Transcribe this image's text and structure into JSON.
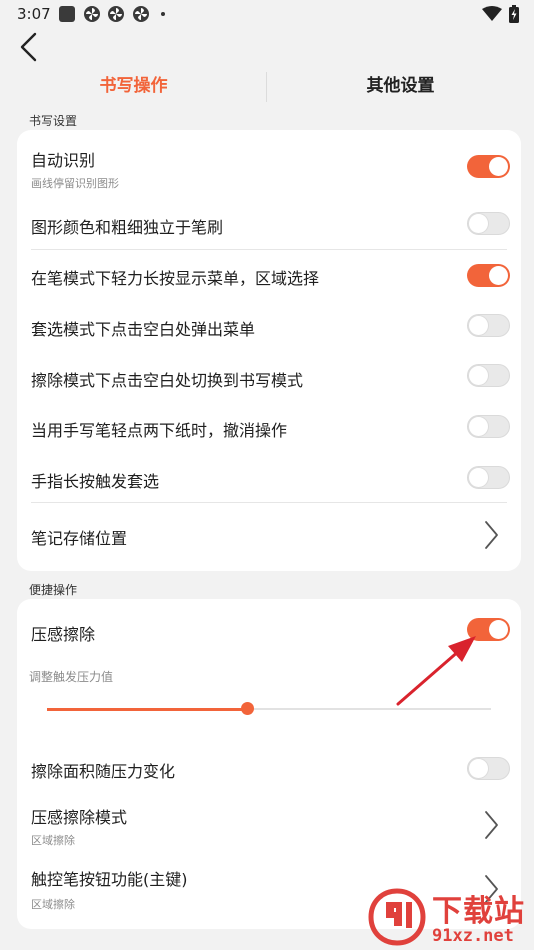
{
  "status_bar": {
    "time": "3:07",
    "icons": [
      "photo-icon",
      "pinwheel-icon",
      "pinwheel-icon",
      "pinwheel-icon",
      "dot-icon",
      "wifi-icon",
      "battery-charging-icon"
    ]
  },
  "header": {
    "back_icon": "back-chevron-icon",
    "tabs": [
      {
        "label": "书写操作",
        "active": true
      },
      {
        "label": "其他设置",
        "active": false
      }
    ]
  },
  "sections": [
    {
      "label": "书写设置",
      "items": [
        {
          "label": "自动识别",
          "subtitle": "画线停留识别图形",
          "control": "toggle",
          "on": true
        },
        {
          "label": "图形颜色和粗细独立于笔刷",
          "control": "toggle",
          "on": false
        },
        {
          "label": "在笔模式下轻力长按显示菜单，区域选择",
          "control": "toggle",
          "on": true
        },
        {
          "label": "套选模式下点击空白处弹出菜单",
          "control": "toggle",
          "on": false
        },
        {
          "label": "擦除模式下点击空白处切换到书写模式",
          "control": "toggle",
          "on": false
        },
        {
          "label": "当用手写笔轻点两下纸时，撤消操作",
          "control": "toggle",
          "on": false
        },
        {
          "label": "手指长按触发套选",
          "control": "toggle",
          "on": false
        },
        {
          "label": "笔记存储位置",
          "control": "chevron"
        }
      ]
    },
    {
      "label": "便捷操作",
      "items": [
        {
          "label": "压感擦除",
          "control": "toggle",
          "on": true
        },
        {
          "label": "调整触发压力值",
          "control": "slider",
          "value_fraction": 0.45
        },
        {
          "label": "擦除面积随压力变化",
          "control": "toggle",
          "on": false
        },
        {
          "label": "压感擦除模式",
          "subtitle": "区域擦除",
          "control": "chevron"
        },
        {
          "label": "触控笔按钮功能(主键)",
          "subtitle": "区域擦除",
          "control": "chevron"
        }
      ]
    }
  ],
  "annotation": {
    "icon": "red-arrow-icon",
    "color": "#d9232d"
  },
  "watermark": {
    "text": "下载站",
    "url": "91xz.net",
    "logo_icon": "91-logo-icon"
  },
  "colors": {
    "accent": "#f2643a",
    "background": "#f2f2f2",
    "card": "#ffffff",
    "watermark": "#e0413c"
  }
}
